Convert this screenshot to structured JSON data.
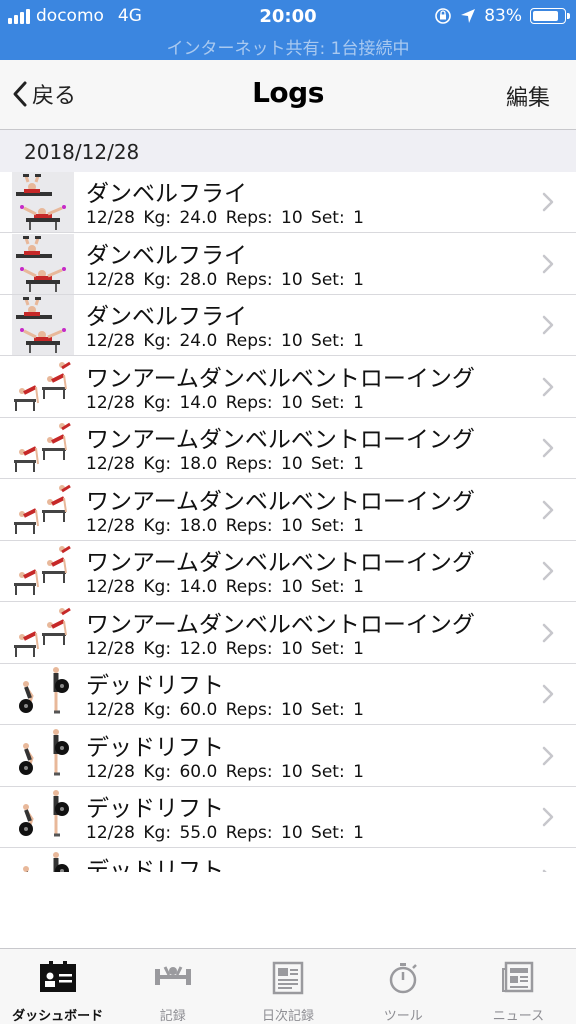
{
  "status_bar": {
    "carrier": "docomo",
    "network": "4G",
    "time": "20:00",
    "battery": "83%",
    "battery_level": 0.83,
    "hotspot": "インターネット共有: 1台接続中"
  },
  "nav": {
    "back_label": "戻る",
    "title": "Logs",
    "edit_label": "編集"
  },
  "section": {
    "date": "2018/12/28"
  },
  "logs": [
    {
      "name": "ダンベルフライ",
      "detail": "12/28  Kg: 24.0  Reps: 10  Set: 1",
      "icon": "dumbbell-fly-icon"
    },
    {
      "name": "ダンベルフライ",
      "detail": "12/28  Kg: 28.0  Reps: 10  Set: 1",
      "icon": "dumbbell-fly-icon"
    },
    {
      "name": "ダンベルフライ",
      "detail": "12/28  Kg: 24.0  Reps: 10  Set: 1",
      "icon": "dumbbell-fly-icon"
    },
    {
      "name": "ワンアームダンベルベントローイング",
      "detail": "12/28  Kg: 14.0  Reps: 10  Set: 1",
      "icon": "one-arm-row-icon"
    },
    {
      "name": "ワンアームダンベルベントローイング",
      "detail": "12/28  Kg: 18.0  Reps: 10  Set: 1",
      "icon": "one-arm-row-icon"
    },
    {
      "name": "ワンアームダンベルベントローイング",
      "detail": "12/28  Kg: 18.0  Reps: 10  Set: 1",
      "icon": "one-arm-row-icon"
    },
    {
      "name": "ワンアームダンベルベントローイング",
      "detail": "12/28  Kg: 14.0  Reps: 10  Set: 1",
      "icon": "one-arm-row-icon"
    },
    {
      "name": "ワンアームダンベルベントローイング",
      "detail": "12/28  Kg: 12.0  Reps: 10  Set: 1",
      "icon": "one-arm-row-icon"
    },
    {
      "name": "デッドリフト",
      "detail": "12/28  Kg: 60.0  Reps: 10  Set: 1",
      "icon": "deadlift-icon"
    },
    {
      "name": "デッドリフト",
      "detail": "12/28  Kg: 60.0  Reps: 10  Set: 1",
      "icon": "deadlift-icon"
    },
    {
      "name": "デッドリフト",
      "detail": "12/28  Kg: 55.0  Reps: 10  Set: 1",
      "icon": "deadlift-icon"
    },
    {
      "name": "デッドリフト",
      "detail": "",
      "icon": "deadlift-icon"
    }
  ],
  "tabs": [
    {
      "label": "ダッシュボード",
      "icon": "dashboard-icon",
      "active": true
    },
    {
      "label": "記録",
      "icon": "barbell-icon",
      "active": false
    },
    {
      "label": "日次記録",
      "icon": "daily-log-icon",
      "active": false
    },
    {
      "label": "ツール",
      "icon": "stopwatch-icon",
      "active": false
    },
    {
      "label": "ニュース",
      "icon": "news-icon",
      "active": false
    }
  ],
  "colors": {
    "status_bar": "#3b86e0",
    "section_bg": "#efeff4",
    "chevron": "#c7c7cc"
  }
}
